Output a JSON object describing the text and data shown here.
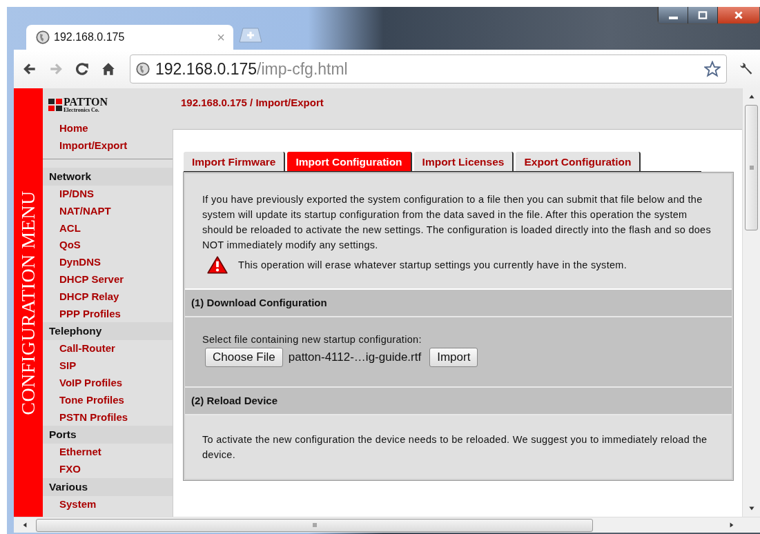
{
  "browser": {
    "tab": {
      "title": "192.168.0.175",
      "close": "×"
    },
    "address": {
      "host": "192.168.0.175",
      "path": "/imp-cfg.html"
    }
  },
  "side_banner": "CONFIGURATION MENU",
  "logo": {
    "name": "PATTON",
    "tagline": "Electronics Co."
  },
  "top_links": [
    "Home",
    "Import/Export"
  ],
  "sidebar": [
    {
      "label": "Network",
      "children": [
        "IP/DNS",
        "NAT/NAPT",
        "ACL",
        "QoS",
        "DynDNS",
        "DHCP Server",
        "DHCP Relay",
        "PPP Profiles"
      ]
    },
    {
      "label": "Telephony",
      "children": [
        "Call-Router",
        "SIP",
        "VoIP Profiles",
        "Tone Profiles",
        "PSTN Profiles"
      ]
    },
    {
      "label": "Ports",
      "children": [
        "Ethernet",
        "FXO"
      ]
    },
    {
      "label": "Various",
      "children": [
        "System"
      ]
    }
  ],
  "breadcrumb": "192.168.0.175 / Import/Export",
  "tabs": [
    {
      "label": "Import Firmware",
      "selected": false
    },
    {
      "label": "Import Configuration",
      "selected": true
    },
    {
      "label": "Import Licenses",
      "selected": false
    },
    {
      "label": "Export Configuration",
      "selected": false
    }
  ],
  "intro": "If you have previously exported the system configuration to a file then you can submit that file below and the system will update its startup configuration from the data saved in the file. After this operation the system should be reloaded to activate the new settings. The configuration is loaded directly into the flash and so does NOT immediately modify any settings.",
  "warning": "This operation will erase whatever startup settings you currently have in the system.",
  "download": {
    "title": "(1) Download Configuration",
    "label": "Select file containing new startup configuration:",
    "choose_button": "Choose File",
    "file_name": "patton-4112-…ig-guide.rtf",
    "import_button": "Import"
  },
  "reload": {
    "title": "(2) Reload Device",
    "text": "To activate the new configuration the device needs to be reloaded. We suggest you to immediately reload the device."
  }
}
